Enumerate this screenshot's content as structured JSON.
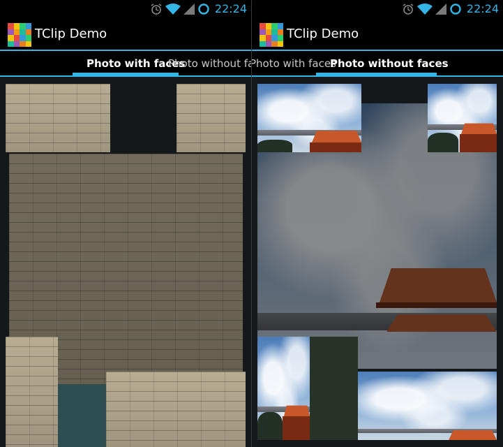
{
  "status_bar": {
    "time": "22:24",
    "icons": [
      "alarm-icon",
      "wifi-icon",
      "cell-signal-icon",
      "sync-icon"
    ],
    "accent_color": "#33b5e5"
  },
  "action_bar": {
    "app_title": "TClip Demo",
    "app_icon": "tclip-grid-icon"
  },
  "screens": [
    {
      "tabs": [
        {
          "label": "Photo with faces",
          "active": true
        },
        {
          "label": "Photo without faces",
          "active": false
        }
      ]
    },
    {
      "tabs": [
        {
          "label": "Photo with faces",
          "active": false
        },
        {
          "label": "Photo without faces",
          "active": true
        }
      ]
    }
  ],
  "colors": {
    "accent": "#33b5e5",
    "background": "#000000",
    "content_background": "#15181b"
  }
}
